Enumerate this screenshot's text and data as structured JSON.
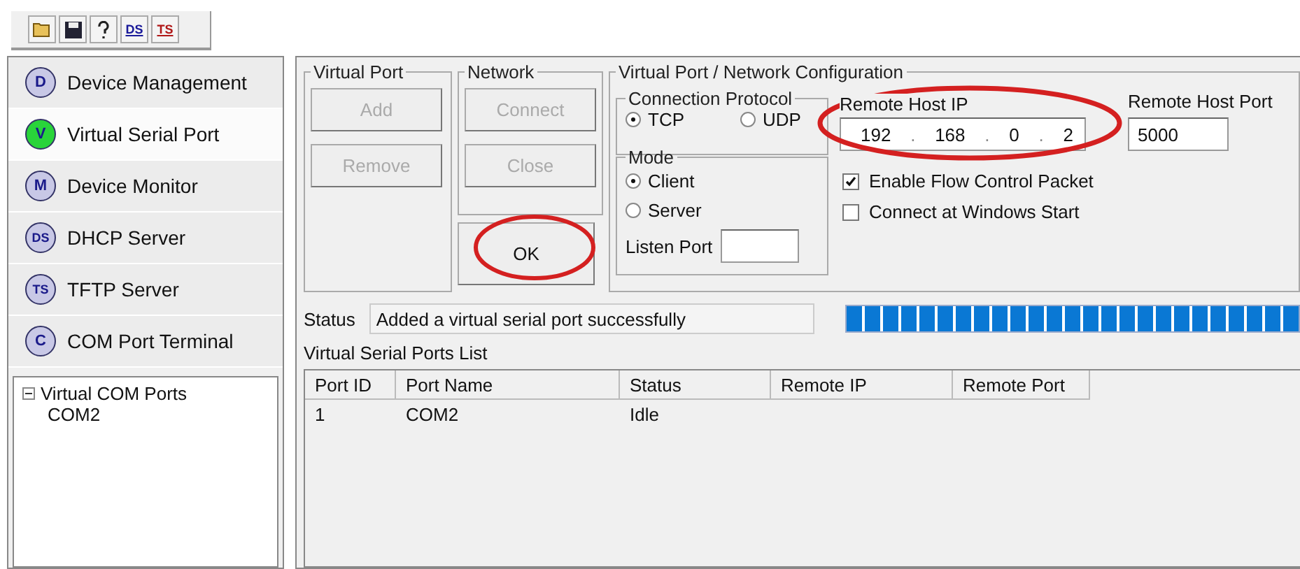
{
  "toolbar": [
    {
      "kind": "open"
    },
    {
      "kind": "save"
    },
    {
      "kind": "help"
    },
    {
      "kind": "ds",
      "label": "DS"
    },
    {
      "kind": "ts",
      "label": "TS"
    }
  ],
  "nav": [
    {
      "badge": "D",
      "label": "Device Management",
      "selected": false
    },
    {
      "badge": "V",
      "label": "Virtual Serial Port",
      "selected": true
    },
    {
      "badge": "M",
      "label": "Device Monitor",
      "selected": false
    },
    {
      "badge": "DS",
      "label": "DHCP Server",
      "selected": false
    },
    {
      "badge": "TS",
      "label": "TFTP Server",
      "selected": false
    },
    {
      "badge": "C",
      "label": "COM Port Terminal",
      "selected": false
    }
  ],
  "tree": [
    {
      "label": "Virtual COM Ports",
      "expanded": true,
      "children": [
        {
          "label": "COM2"
        }
      ]
    }
  ],
  "virtual_port": {
    "title": "Virtual Port",
    "buttons": [
      {
        "label": "Add",
        "disabled": true
      },
      {
        "label": "Remove",
        "disabled": true
      }
    ]
  },
  "network": {
    "title": "Network",
    "buttons": [
      {
        "label": "Connect",
        "disabled": true
      },
      {
        "label": "Close",
        "disabled": true
      }
    ]
  },
  "ok_button": {
    "label": "OK",
    "disabled": false
  },
  "config": {
    "title": "Virtual Port / Network Configuration",
    "protocol": {
      "title": "Connection Protocol",
      "options": [
        {
          "label": "TCP",
          "selected": true
        },
        {
          "label": "UDP",
          "selected": false
        }
      ]
    },
    "mode": {
      "title": "Mode",
      "options": [
        {
          "label": "Client",
          "selected": true
        },
        {
          "label": "Server",
          "selected": false
        }
      ],
      "listen_port_label": "Listen Port"
    },
    "remote_ip_label": "Remote Host IP",
    "remote_ip": [
      "192",
      "168",
      "0",
      "2"
    ],
    "ip_separator": ".",
    "remote_port_label": "Remote Host Port",
    "remote_port": "5000",
    "checkboxes": [
      {
        "label": "Enable Flow Control Packet",
        "checked": true
      },
      {
        "label": "Connect at Windows Start",
        "checked": false
      }
    ]
  },
  "status": {
    "label": "Status",
    "text": "Added a virtual serial port successfully",
    "level": 1
  },
  "list": {
    "title": "Virtual Serial Ports List",
    "columns": [
      "Port ID",
      "Port Name",
      "Status",
      "Remote IP",
      "Remote Port"
    ],
    "rows": [
      [
        "1",
        "COM2",
        "Idle",
        "",
        ""
      ]
    ]
  }
}
